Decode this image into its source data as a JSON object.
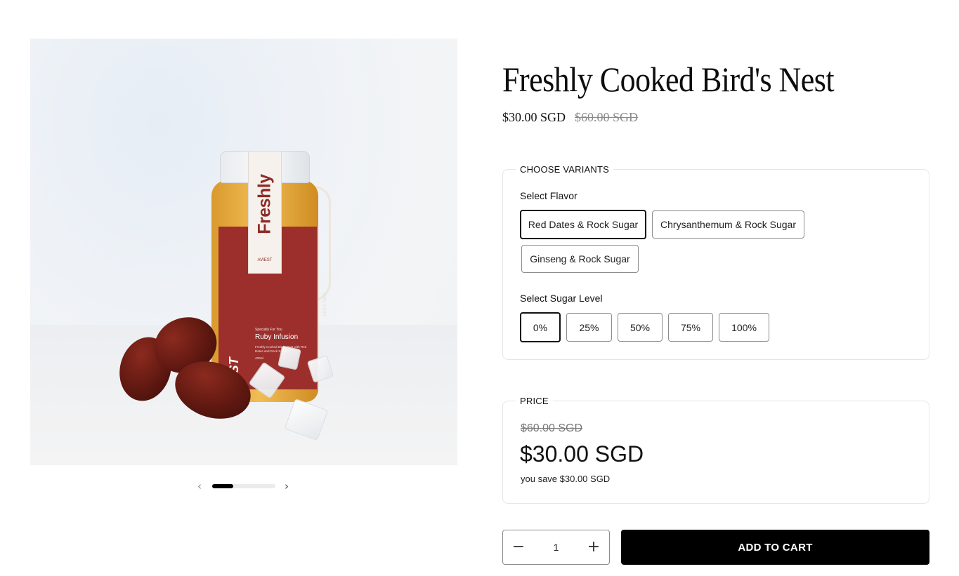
{
  "product": {
    "title": "Freshly Cooked Bird's Nest",
    "price": "$30.00 SGD",
    "compare_price": "$60.00 SGD"
  },
  "image": {
    "tag_text": "Freshly",
    "tag_brand": "AVIEST",
    "brand_vertical": "AVIEST",
    "side_text": "Bird's Nest",
    "infusion_sub": "Specially For You",
    "infusion_title": "Ruby Infusion",
    "infusion_desc": "Freshly Cooked Bird's Nest with Red Dates and Rock Sugar",
    "volume": "400ml"
  },
  "carousel": {
    "prev_icon": "chevron-left-icon",
    "next_icon": "chevron-right-icon",
    "progress": 0.33
  },
  "variants": {
    "legend": "CHOOSE VARIANTS",
    "flavor_label": "Select Flavor",
    "flavors": [
      "Red Dates & Rock Sugar",
      "Chrysanthemum & Rock Sugar",
      "Ginseng & Rock Sugar"
    ],
    "selected_flavor": "Red Dates & Rock Sugar",
    "sugar_label": "Select Sugar Level",
    "sugar_levels": [
      "0%",
      "25%",
      "50%",
      "75%",
      "100%"
    ],
    "selected_sugar": "0%"
  },
  "price_box": {
    "legend": "PRICE",
    "old": "$60.00 SGD",
    "current": "$30.00 SGD",
    "savings": "you save $30.00 SGD"
  },
  "cart": {
    "quantity": "1",
    "minus_icon": "minus-icon",
    "plus_icon": "plus-icon",
    "add_label": "ADD TO CART"
  },
  "colors": {
    "accent": "#000000",
    "border": "#8c8c8c",
    "muted": "#8a8a8a",
    "label_red": "#9c2f2c"
  }
}
